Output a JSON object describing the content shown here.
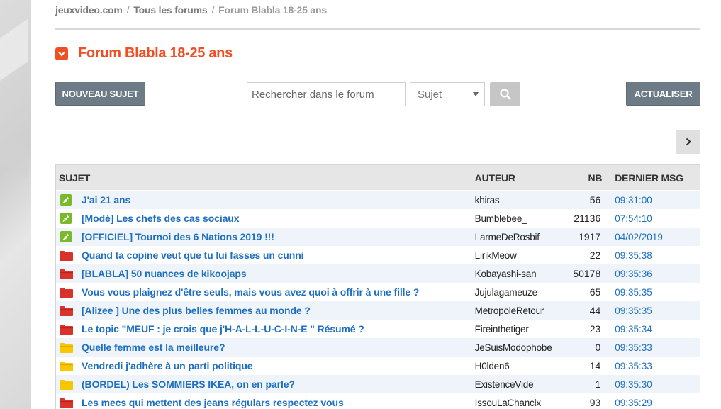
{
  "breadcrumb": {
    "site": "jeuxvideo.com",
    "forums": "Tous les forums",
    "current": "Forum Blabla 18-25 ans",
    "separator": "/"
  },
  "forum": {
    "title": "Forum Blabla 18-25 ans"
  },
  "toolbar": {
    "new_topic_label": "NOUVEAU SUJET",
    "search_placeholder": "Rechercher dans le forum",
    "search_scope": "Sujet",
    "refresh_label": "ACTUALISER"
  },
  "table": {
    "headers": {
      "subject": "SUJET",
      "author": "AUTEUR",
      "nb": "NB",
      "last": "DERNIER MSG"
    },
    "rows": [
      {
        "icon": "pinned-icon",
        "title": "J'ai 21 ans",
        "author": "khiras",
        "nb": "56",
        "last": "09:31:00"
      },
      {
        "icon": "pinned-icon",
        "title": "[Modé] Les chefs des cas sociaux",
        "author": "Bumblebee_",
        "nb": "21136",
        "last": "07:54:10"
      },
      {
        "icon": "pinned-icon",
        "title": "[OFFICIEL] Tournoi des 6 Nations 2019 !!!",
        "author": "LarmeDeRosbif",
        "nb": "1917",
        "last": "04/02/2019"
      },
      {
        "icon": "hot-folder-icon",
        "title": "Quand ta copine veut que tu lui fasses un cunni",
        "author": "LirikMeow",
        "nb": "22",
        "last": "09:35:38"
      },
      {
        "icon": "hot-folder-icon",
        "title": "[BLABLA] 50 nuances de kikoojaps",
        "author": "Kobayashi-san",
        "nb": "50178",
        "last": "09:35:36"
      },
      {
        "icon": "hot-folder-icon",
        "title": "Vous vous plaignez d'être seuls, mais vous avez quoi à offrir à une fille ?",
        "author": "Jujulagameuze",
        "nb": "65",
        "last": "09:35:35"
      },
      {
        "icon": "hot-folder-icon",
        "title": "[Alizee ] Une des plus belles femmes au monde ?",
        "author": "MetropoleRetour",
        "nb": "44",
        "last": "09:35:35"
      },
      {
        "icon": "hot-folder-icon",
        "title": "Le topic \"MEUF : je crois que j'H-A-L-L-U-C-I-N-E \" Résumé ?",
        "author": "Fireinthetiger",
        "nb": "23",
        "last": "09:35:34"
      },
      {
        "icon": "folder-icon",
        "title": "Quelle femme est la meilleure?",
        "author": "JeSuisModophobe",
        "nb": "0",
        "last": "09:35:33"
      },
      {
        "icon": "folder-icon",
        "title": "Vendredi j'adhère à un parti politique",
        "author": "H0lden6",
        "nb": "14",
        "last": "09:35:33"
      },
      {
        "icon": "folder-icon",
        "title": "(BORDEL) Les SOMMIERS IKEA, on en parle?",
        "author": "ExistenceVide",
        "nb": "1",
        "last": "09:35:30"
      },
      {
        "icon": "hot-folder-icon",
        "title": "Les mecs qui mettent des jeans régulars respectez vous",
        "author": "IssouLaChanclx",
        "nb": "93",
        "last": "09:35:29"
      }
    ]
  },
  "colors": {
    "accent": "#f04e23",
    "link": "#1e6fc0",
    "pinned": "#7ab929",
    "hot_folder": "#d9342b",
    "folder": "#f7c800"
  }
}
